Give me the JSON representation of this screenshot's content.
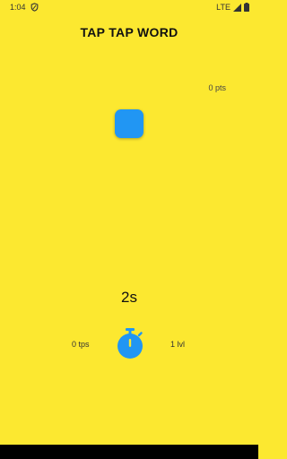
{
  "status_bar": {
    "time": "1:04",
    "network": "LTE"
  },
  "header": {
    "title": "TAP TAP WORD"
  },
  "game": {
    "points": "0 pts",
    "timer": "2s",
    "tps": "0 tps",
    "level": "1 lvl"
  },
  "colors": {
    "background": "#FCE830",
    "accent": "#2196F3",
    "nav_bar": "#000000"
  },
  "icons": {
    "status_shield": "shield-icon",
    "signal": "signal-icon",
    "battery": "battery-icon",
    "stopwatch": "stopwatch-icon"
  }
}
